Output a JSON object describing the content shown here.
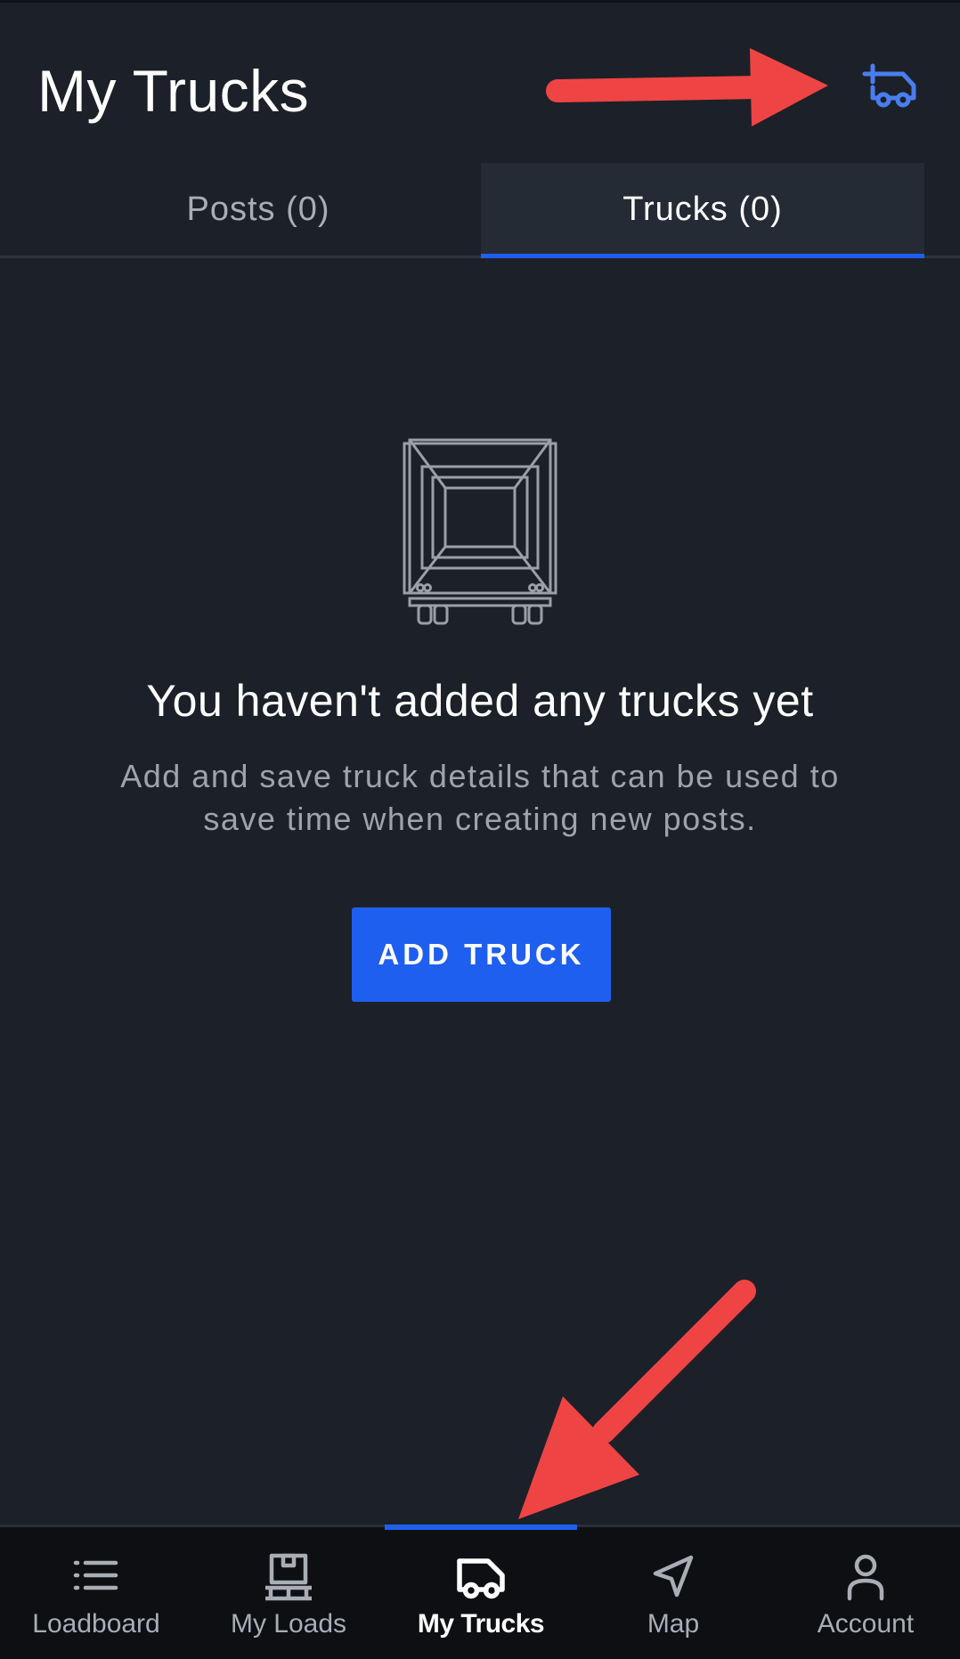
{
  "header": {
    "title": "My Trucks",
    "add_truck_icon": "add-truck-icon"
  },
  "tabs": [
    {
      "label": "Posts (0)",
      "active": false
    },
    {
      "label": "Trucks (0)",
      "active": true
    }
  ],
  "empty_state": {
    "illustration": "truck-trailer-rear-illustration",
    "title": "You haven't added any trucks yet",
    "description": "Add and save truck details that can be used to save time when creating new posts.",
    "button_label": "ADD TRUCK"
  },
  "bottom_nav": {
    "items": [
      {
        "label": "Loadboard",
        "icon": "list-icon",
        "active": false
      },
      {
        "label": "My Loads",
        "icon": "load-box-icon",
        "active": false
      },
      {
        "label": "My Trucks",
        "icon": "truck-icon",
        "active": true
      },
      {
        "label": "Map",
        "icon": "navigation-arrow-icon",
        "active": false
      },
      {
        "label": "Account",
        "icon": "person-icon",
        "active": false
      }
    ]
  },
  "colors": {
    "background": "#1c2028",
    "accent": "#1f5ff0",
    "annotation_arrow": "#ef4444",
    "nav_background": "#0d0f13"
  }
}
